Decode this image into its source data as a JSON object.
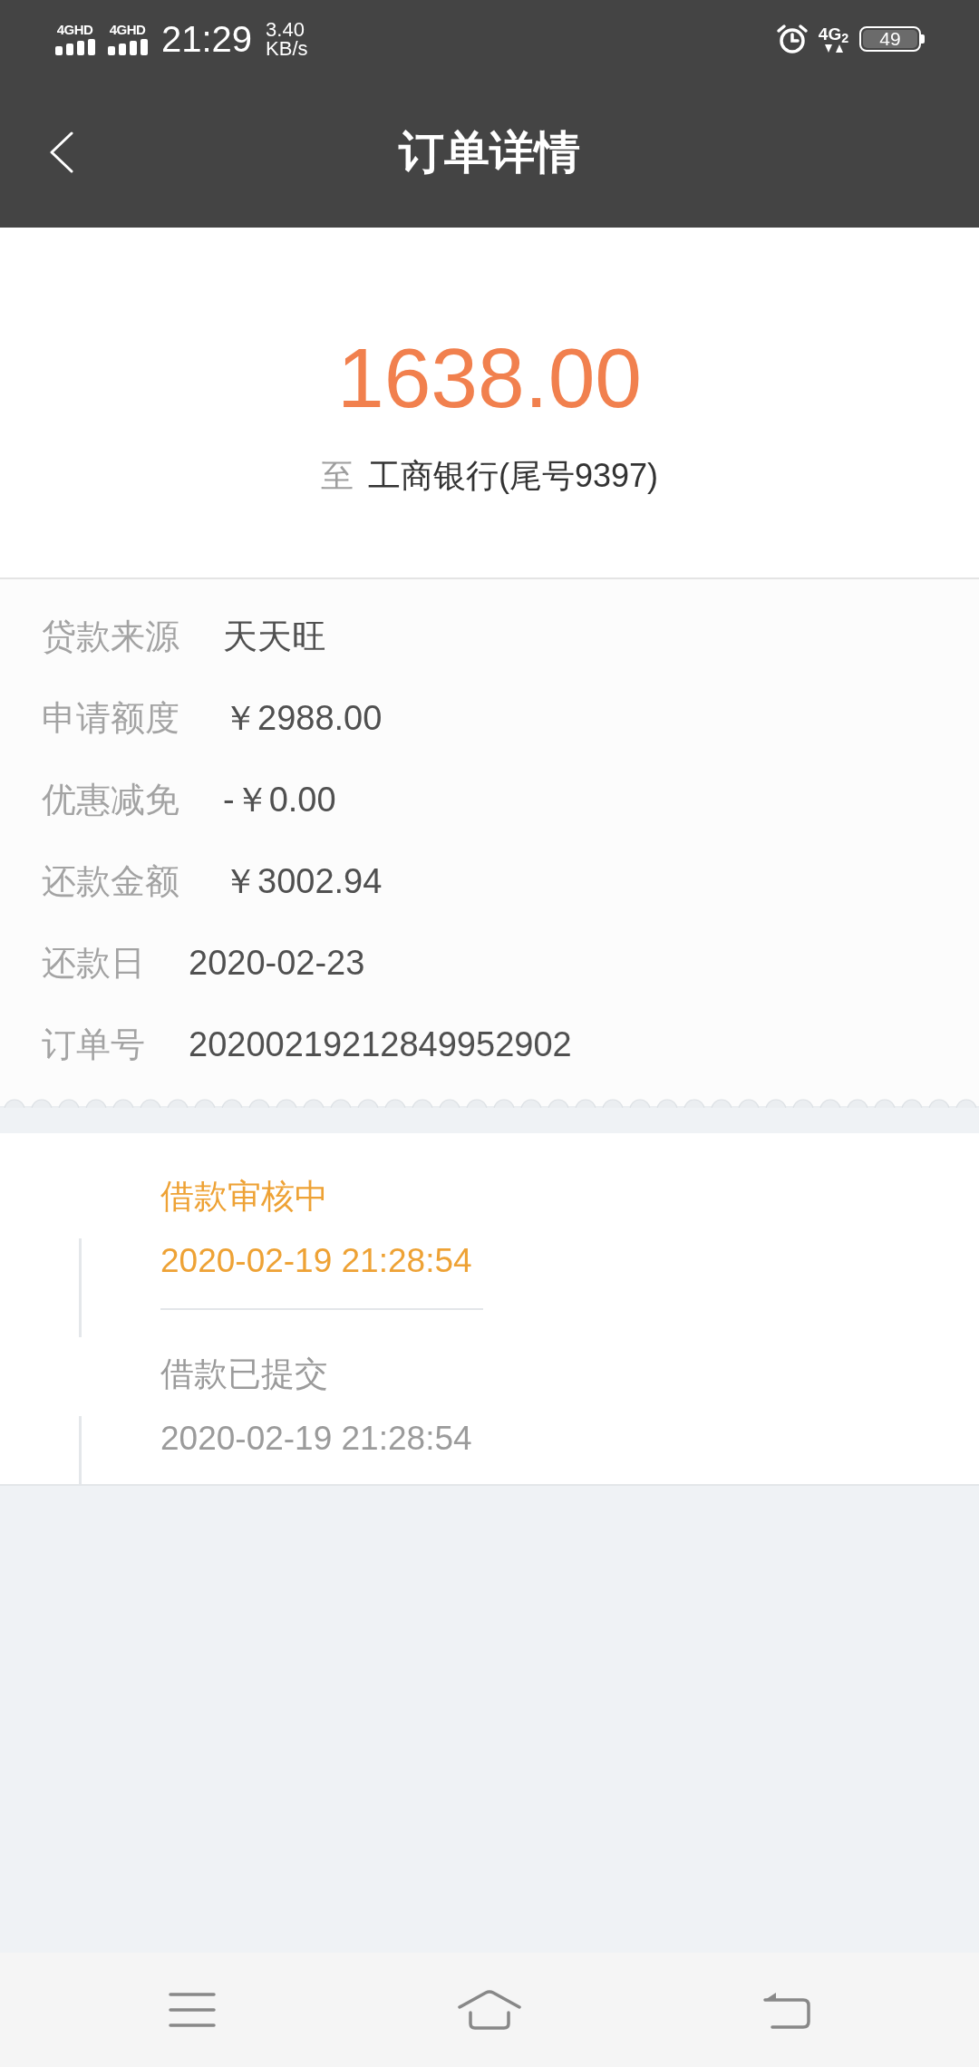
{
  "status_bar": {
    "signals": [
      {
        "label": "4GHD"
      },
      {
        "label": "4GHD"
      }
    ],
    "time": "21:29",
    "speed": "3.40",
    "speed_unit": "KB/s",
    "network": "4G$_{2}$",
    "battery": "49"
  },
  "header": {
    "title": "订单详情"
  },
  "summary": {
    "amount": "1638.00",
    "prefix": "至",
    "account": "工商银行(尾号9397)"
  },
  "details": [
    {
      "label": "贷款来源",
      "value": "天天旺"
    },
    {
      "label": "申请额度",
      "value": "￥2988.00"
    },
    {
      "label": "优惠减免",
      "value": "-￥0.00"
    },
    {
      "label": "还款金额",
      "value": "￥3002.94"
    },
    {
      "label": "还款日",
      "value": "2020-02-23"
    },
    {
      "label": "订单号",
      "value": "20200219212849952902"
    }
  ],
  "timeline": [
    {
      "title": "借款审核中",
      "time": "2020-02-19 21:28:54",
      "active": true
    },
    {
      "title": "借款已提交",
      "time": "2020-02-19 21:28:54",
      "active": false
    }
  ]
}
